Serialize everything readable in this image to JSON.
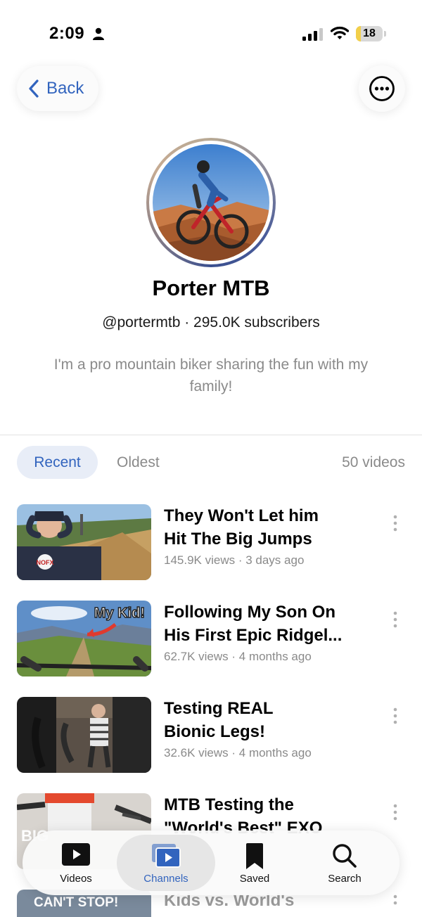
{
  "status_bar": {
    "time": "2:09",
    "battery": "18",
    "battery_level": 0.18
  },
  "nav": {
    "back_label": "Back"
  },
  "channel": {
    "name": "Porter MTB",
    "meta": "@portermtb · 295.0K subscribers",
    "description": "I'm a pro mountain biker sharing the fun with my family!"
  },
  "sort": {
    "recent_label": "Recent",
    "oldest_label": "Oldest",
    "video_count": "50 videos"
  },
  "videos": [
    {
      "title": "They Won't Let him\nHit The Big Jumps",
      "meta": "145.9K views · 3 days ago"
    },
    {
      "title": "Following My Son On\nHis First Epic Ridgel...",
      "meta": "62.7K views · 4 months ago",
      "thumb_text": "My Kid!"
    },
    {
      "title": "Testing REAL\nBionic Legs!",
      "meta": "32.6K views · 4 months ago"
    },
    {
      "title": "MTB Testing the\n\"World's Best\" EXO",
      "meta": "",
      "thumb_text": "BIG"
    },
    {
      "title": "Kids vs. World's",
      "meta": "",
      "thumb_text": "CAN'T STOP!"
    }
  ],
  "tabbar": {
    "items": [
      {
        "label": "Videos",
        "icon": "play-icon"
      },
      {
        "label": "Channels",
        "icon": "channels-icon"
      },
      {
        "label": "Saved",
        "icon": "bookmark-icon"
      },
      {
        "label": "Search",
        "icon": "search-icon"
      }
    ],
    "active": "Channels"
  },
  "colors": {
    "accent": "#3264be",
    "secondary_text": "#8a8a8a",
    "recent_pill": "#e8edf7",
    "battery": "#f2cf4a"
  }
}
